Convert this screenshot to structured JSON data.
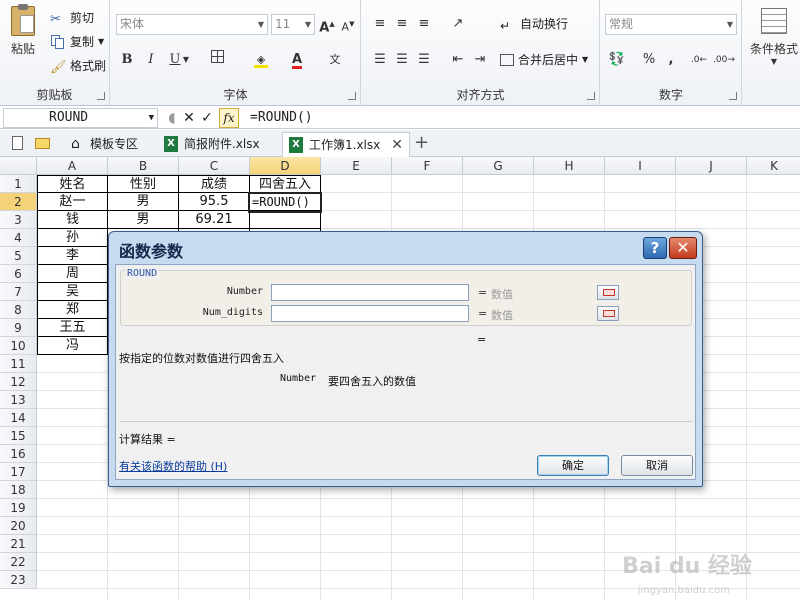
{
  "ribbon": {
    "clipboard": {
      "paste": "粘贴",
      "cut": "剪切",
      "copy": "复制",
      "format_painter": "格式刷",
      "group": "剪贴板"
    },
    "font": {
      "font_name": "宋体",
      "font_size": "11",
      "group": "字体",
      "bold": "B",
      "italic": "I",
      "underline": "U",
      "grow": "A",
      "shrink": "A"
    },
    "alignment": {
      "wrap_text": "自动换行",
      "merge_center": "合并后居中",
      "group": "对齐方式"
    },
    "number": {
      "format": "常规",
      "percent": "%",
      "comma": ",",
      "group": "数字"
    },
    "styles": {
      "conditional": "条件格式"
    }
  },
  "formula_bar": {
    "name_box": "ROUND",
    "formula": "=ROUND()"
  },
  "tabs": [
    {
      "label": "模板专区"
    },
    {
      "label": "简报附件.xlsx"
    },
    {
      "label": "工作簿1.xlsx"
    }
  ],
  "grid": {
    "columns": [
      "A",
      "B",
      "C",
      "D",
      "E",
      "F",
      "G",
      "H",
      "I",
      "J",
      "K"
    ],
    "rows": [
      "1",
      "2",
      "3",
      "4",
      "5",
      "6",
      "7",
      "8",
      "9",
      "10",
      "11",
      "12",
      "13",
      "14",
      "15",
      "16",
      "17",
      "18",
      "19",
      "20",
      "21",
      "22",
      "23"
    ],
    "cells": {
      "A1": "姓名",
      "B1": "性别",
      "C1": "成绩",
      "D1": "四舍五入",
      "A2": "赵一",
      "B2": "男",
      "C2": "95.5",
      "D2": "=ROUND()",
      "A3": "钱",
      "B3": "男",
      "C3": "69.21",
      "A4": "孙",
      "A5": "李",
      "A6": "周",
      "A7": "吴",
      "A8": "郑",
      "A9": "王五",
      "A10": "冯"
    }
  },
  "dialog": {
    "title": "函数参数",
    "help_label": "?",
    "close_label": "✕",
    "function_name": "ROUND",
    "args": [
      {
        "name": "Number",
        "eq": "=",
        "value": "数值"
      },
      {
        "name": "Num_digits",
        "eq": "=",
        "value": "数值"
      }
    ],
    "result_eq": "=",
    "description": "按指定的位数对数值进行四舍五入",
    "arg_help_name": "Number",
    "arg_help_text": "要四舍五入的数值",
    "result_label": "计算结果 =",
    "help_link": "有关该函数的帮助 (H)",
    "ok": "确定",
    "cancel": "取消"
  },
  "watermark": {
    "brand": "Bai du 经验",
    "url": "jingyan.baidu.com"
  }
}
